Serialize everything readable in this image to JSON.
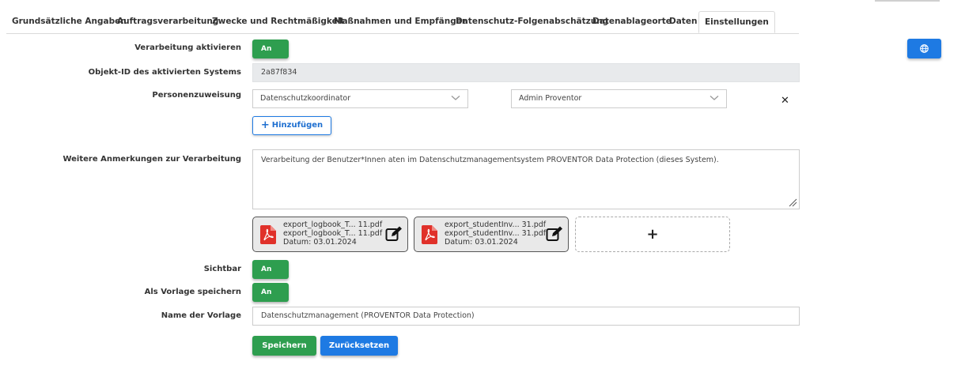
{
  "tabs": [
    {
      "label": "Grundsätzliche Angaben"
    },
    {
      "label": "Auftragsverarbeitung"
    },
    {
      "label": "Zwecke und Rechtmäßigkeit"
    },
    {
      "label": "Maßnahmen und Empfänger"
    },
    {
      "label": "Datenschutz-Folgenabschätzung"
    },
    {
      "label": "Datenablageorte"
    },
    {
      "label": "Daten"
    },
    {
      "label": "Einstellungen"
    }
  ],
  "active_tab": "Einstellungen",
  "form": {
    "activate_label": "Verarbeitung aktivieren",
    "activate_value": "An",
    "object_id_label": "Objekt-ID des aktivierten Systems",
    "object_id_value": "2a87f834",
    "person_label": "Personenzuweisung",
    "person_role": "Datenschutzkoordinator",
    "person_name": "Admin Proventor",
    "add_button": "Hinzufügen",
    "notes_label": "Weitere Anmerkungen zur Verarbeitung",
    "notes_value": "Verarbeitung der Benutzer*Innen aten im Datenschutzmanagementsystem PROVENTOR Data Protection (dieses System).",
    "files": [
      {
        "line1": "export_logbook_T...  11.pdf",
        "line2": "export_logbook_T...  11.pdf",
        "date": "Datum: 03.01.2024"
      },
      {
        "line1": "export_studentInv...  31.pdf",
        "line2": "export_studentInv...  31.pdf",
        "date": "Datum: 03.01.2024"
      }
    ],
    "add_file_symbol": "+",
    "visible_label": "Sichtbar",
    "visible_value": "An",
    "template_label": "Als Vorlage speichern",
    "template_value": "An",
    "template_name_label": "Name der Vorlage",
    "template_name_value": "Datenschutzmanagement (PROVENTOR Data Protection)",
    "save_button": "Speichern",
    "reset_button": "Zurücksetzen"
  },
  "icons": {
    "globe": "globe-icon",
    "chevron": "chevron-down-icon",
    "close": "close-icon",
    "pdf": "pdf-file-icon",
    "edit": "edit-icon",
    "plus": "plus-icon"
  },
  "colors": {
    "green": "#2e9e4f",
    "blue": "#1e7ae3",
    "pdf_red": "#e0312a"
  }
}
